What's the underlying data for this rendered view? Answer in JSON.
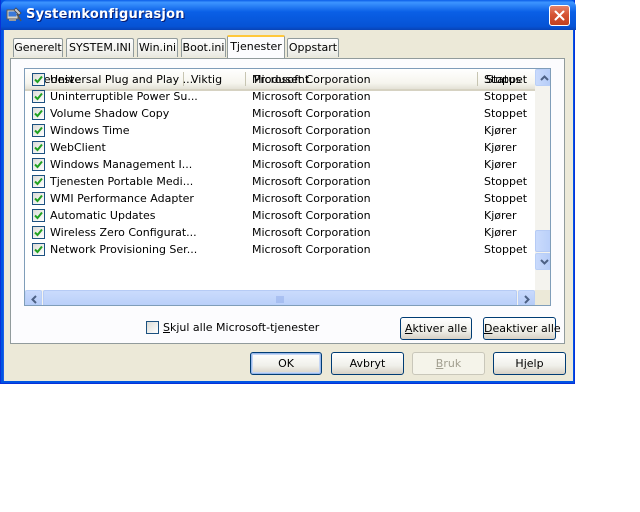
{
  "window": {
    "title": "Systemkonfigurasjon",
    "icon": "msconfig-icon",
    "close_icon": "close-icon"
  },
  "tabs": [
    {
      "label": "Generelt",
      "active": false
    },
    {
      "label": "SYSTEM.INI",
      "active": false
    },
    {
      "label": "Win.ini",
      "active": false
    },
    {
      "label": "Boot.ini",
      "active": false
    },
    {
      "label": "Tjenester",
      "active": true
    },
    {
      "label": "Oppstart",
      "active": false
    }
  ],
  "services": {
    "columns": [
      "Tjeneste",
      "Viktig",
      "Produsent",
      "Status"
    ],
    "rows": [
      {
        "name": "Universal Plug and Play ...",
        "important": "",
        "manufacturer": "Microsoft Corporation",
        "status": "Stoppet",
        "checked": true
      },
      {
        "name": "Uninterruptible Power Su...",
        "important": "",
        "manufacturer": "Microsoft Corporation",
        "status": "Stoppet",
        "checked": true
      },
      {
        "name": "Volume Shadow Copy",
        "important": "",
        "manufacturer": "Microsoft Corporation",
        "status": "Stoppet",
        "checked": true
      },
      {
        "name": "Windows Time",
        "important": "",
        "manufacturer": "Microsoft Corporation",
        "status": "Kjører",
        "checked": true
      },
      {
        "name": "WebClient",
        "important": "",
        "manufacturer": "Microsoft Corporation",
        "status": "Kjører",
        "checked": true
      },
      {
        "name": "Windows Management I...",
        "important": "",
        "manufacturer": "Microsoft Corporation",
        "status": "Kjører",
        "checked": true
      },
      {
        "name": "Tjenesten Portable Medi...",
        "important": "",
        "manufacturer": "Microsoft Corporation",
        "status": "Stoppet",
        "checked": true
      },
      {
        "name": "WMI Performance Adapter",
        "important": "",
        "manufacturer": "Microsoft Corporation",
        "status": "Stoppet",
        "checked": true
      },
      {
        "name": "Automatic Updates",
        "important": "",
        "manufacturer": "Microsoft Corporation",
        "status": "Kjører",
        "checked": true
      },
      {
        "name": "Wireless Zero Configurat...",
        "important": "",
        "manufacturer": "Microsoft Corporation",
        "status": "Kjører",
        "checked": true
      },
      {
        "name": "Network Provisioning Ser...",
        "important": "",
        "manufacturer": "Microsoft Corporation",
        "status": "Stoppet",
        "checked": true
      }
    ],
    "vertical_scroll_position": 0.95,
    "horizontal_scroll_position": 0.5
  },
  "hide_ms_services": {
    "label": "Skjul alle Microsoft-tjenester",
    "accesskey": "S",
    "checked": false
  },
  "buttons": {
    "enable_all": {
      "label": "Aktiver alle",
      "accesskey": "A"
    },
    "disable_all": {
      "label": "Deaktiver alle",
      "accesskey": "D"
    },
    "ok": {
      "label": "OK"
    },
    "cancel": {
      "label": "Avbryt"
    },
    "apply": {
      "label": "Bruk",
      "accesskey": "B",
      "disabled": true
    },
    "help": {
      "label": "Hjelp",
      "accesskey": "j"
    }
  },
  "colors": {
    "titlebar": "#0a5fe6",
    "active_tab_accent": "#ffc83c",
    "checkmark": "#21a121",
    "scrollbar": "#c1d3fb"
  }
}
